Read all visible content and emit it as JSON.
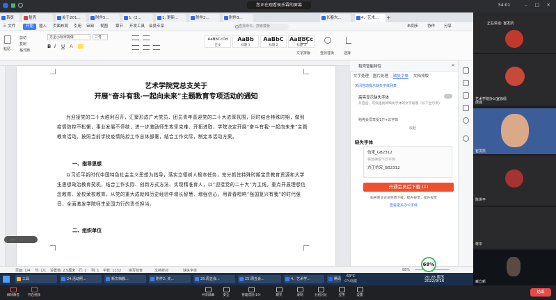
{
  "meeting": {
    "sharing_banner": "您正在观看侯乐霖的屏幕",
    "time": "54:01",
    "bottom_controls": [
      {
        "label": "解除静音"
      },
      {
        "label": "开启视频"
      },
      {
        "label": "共享屏幕"
      },
      {
        "label": "安全"
      },
      {
        "label": "管理成员(19)"
      },
      {
        "label": "聊天"
      },
      {
        "label": "录制"
      },
      {
        "label": "分组讨论"
      },
      {
        "label": "应用"
      },
      {
        "label": "设置"
      }
    ],
    "leave_label": "结束"
  },
  "wps": {
    "tabs": [
      {
        "label": "首页",
        "color": "#2d6df6"
      },
      {
        "label": "稻壳",
        "color": "#e33b3b"
      },
      {
        "label": "关于201...",
        "color": "#2d6df6"
      },
      {
        "label": "附件5...",
        "color": "#2d6df6"
      },
      {
        "label": "1. (2...",
        "color": "#2d6df6"
      },
      {
        "label": "1. 更新...",
        "color": "#2d6df6"
      },
      {
        "label": "附件2...",
        "color": "#2d6df6"
      },
      {
        "label": "附件3...",
        "color": "#2d6df6"
      },
      {
        "label": "长春大...",
        "color": "#2d6df6"
      },
      {
        "label": "4、艺术...",
        "color": "#2d6df6"
      }
    ],
    "menus": [
      "三 文件",
      "开始",
      "插入",
      "页面布局",
      "引用",
      "审阅",
      "视图",
      "章节",
      "开发工具",
      "会员专享"
    ],
    "search_placeholder": "查找命令、搜索模板",
    "menu_right": [
      "未同步",
      "协作",
      "分享"
    ],
    "toolbar": {
      "paste": "粘贴",
      "cut": "剪切",
      "copy": "复制",
      "format_brush": "格式刷",
      "font": "方正小标宋简体",
      "font_size": "二号",
      "styles": [
        {
          "sample": "AaBbCcDd",
          "label": "正文"
        },
        {
          "sample": "AaBb",
          "label": "标题 1"
        },
        {
          "sample": "AaBbC",
          "label": "标题 2"
        },
        {
          "sample": "AaBbCc",
          "label": "标题 3"
        }
      ],
      "text_layout": "文字排版",
      "find_replace": "查找替换",
      "select": "选择"
    },
    "document": {
      "title_line1": "艺术学院党总支关于",
      "title_line2": "开展“奋斗有我·一起向未来”主题教育专项活动的通知",
      "para1": "为迎接党的二十大胜利召开，汇聚形成广大党员、团员青年喜迎党的二十大浓厚氛围，同时结合特殊时期，做到疫情防控不松懈，事业发展不停歇，进一步激励师生攻坚克难、开拓进取，学院决定开展“奋斗有我·一起向未来”主题教育活动。按照当前学校疫情防控工作总体部署，结合工作实际，制定本活动方案。",
      "heading1": "一、指导思想",
      "para2": "以习近平新时代中国特色社会主义思想为指导，落实立德树人根本任务，充分抓住特殊时期宝贵教育资源和大学生思想政治教育契机，结合工作实际、创新方式方法、实现精准育人，以“迎接党的二十大”为主线，重点开展理想信念教育、爱校荣校教育，从党的重大成就和历史经验中增长智慧、增强信心，用青春唱响“强国复兴有我”的时代强音，全面激发学院师生爱国力行的责任担当。",
      "heading2": "二、组织单位"
    },
    "statusbar": {
      "page": "页面: 1/4",
      "section": "节: 1/1",
      "setting": "设置值: 2.5厘米",
      "row": "行: 1",
      "col": "列: 1",
      "words": "字数: 1132",
      "spellcheck": "拼写检查",
      "proofread": "文档校对",
      "missing_font": "缺失字体",
      "zoom": "88%"
    },
    "right_panel": {
      "title": "稻壳智能特性",
      "tabs": [
        "文字处理",
        "图片处理",
        "缺失字体",
        "文档排版"
      ],
      "active_tab": "缺失字体",
      "notice": "关闭自动提示缺失字体列表",
      "toggle_label": "高亮显示缺失字体",
      "toggle_desc": "开启后，可快速找到缺失字体的文字段落（以下显示例）",
      "cloud_label": "稻壳会员享受1万+云字体",
      "collapse": "收起",
      "missing_title": "缺失字体",
      "font_item_1": "仿宋_GB2312",
      "font_item_desc": "将替换成下方字体",
      "font_item_2": "方正仿宋_GB2312",
      "download_button": "开通会员后下载 (1)",
      "member_note": "稻壳商业会员免费下载，提升视觉，提升视觉",
      "more_link": "查看更多办公字体"
    }
  },
  "participants": [
    {
      "name": "正在讲话: 崔发凯"
    },
    {
      "name": "艺术学院办公室徐倩"
    },
    {
      "name": "虎城"
    },
    {
      "name": "崔发凯"
    },
    {
      "name": "陈世平"
    },
    {
      "name": "蒋华"
    },
    {
      "name": "臧立新"
    }
  ],
  "taskbar": {
    "items": [
      "工具",
      "24.活动照...",
      "新文档教...",
      "附件2: 关...",
      "25.周五会...",
      "25.周五会...",
      "4、艺术学...",
      "腾讯会议"
    ],
    "weather": "63°C",
    "weather_label": "CPU温度",
    "clock_time": "20:28 周五",
    "clock_date": "2022/9/16",
    "battery_badge": "68%"
  },
  "colors": {
    "accent": "#2d6df6",
    "download_button": "#f0502f",
    "leave": "#e84a4a"
  }
}
